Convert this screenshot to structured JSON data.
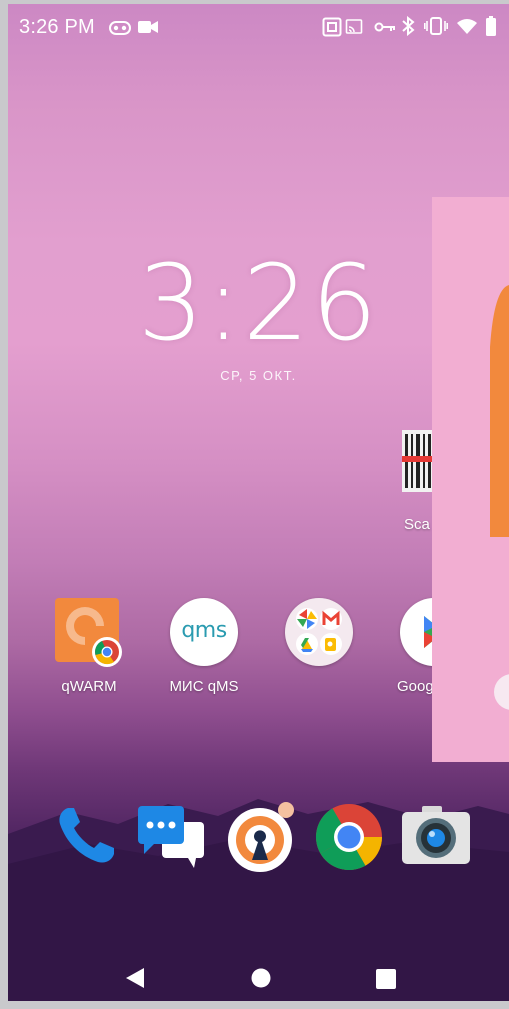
{
  "status_bar": {
    "time": "3:26 PM",
    "icons": [
      "voicemail-icon",
      "video-camera-icon",
      "nfc-icon",
      "cast-icon",
      "vpn-key-icon",
      "bluetooth-icon",
      "vibrate-icon",
      "wifi-icon",
      "battery-icon"
    ]
  },
  "clock_widget": {
    "time": "3:26",
    "date": "СР, 5 ОКТ."
  },
  "partial_app": {
    "label": "Sca",
    "icon": "barcode-scanner-icon"
  },
  "apps_row": [
    {
      "label": "qWARM",
      "icon": "qwarm-chrome-shortcut-icon"
    },
    {
      "label": "МИС qMS",
      "icon": "qms-icon",
      "logo_text": "qms"
    },
    {
      "label": "",
      "icon": "google-folder-icon"
    },
    {
      "label": "Goog",
      "icon": "google-play-icon"
    }
  ],
  "dock": [
    {
      "name": "phone",
      "icon": "phone-icon"
    },
    {
      "name": "messages",
      "icon": "messages-icon"
    },
    {
      "name": "openvpn",
      "icon": "openvpn-icon"
    },
    {
      "name": "chrome",
      "icon": "chrome-icon"
    },
    {
      "name": "camera",
      "icon": "camera-icon"
    }
  ],
  "nav_bar": {
    "buttons": [
      "back-icon",
      "home-icon",
      "recents-icon"
    ]
  },
  "colors": {
    "accent_orange": "#f2893d",
    "overlay_pink": "#f2aed2",
    "phone_blue": "#1e88e5"
  }
}
